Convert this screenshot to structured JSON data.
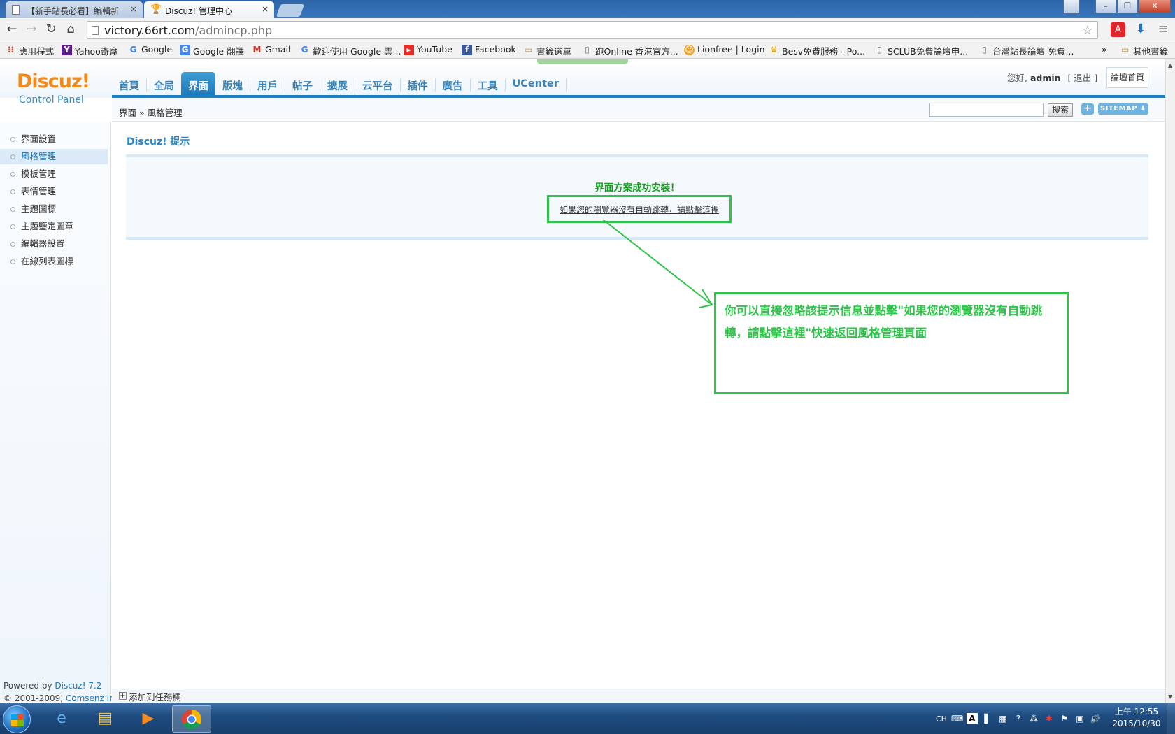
{
  "browser": {
    "tabs": [
      {
        "title": "【新手站長必看】編輯新",
        "active": false
      },
      {
        "title": "Discuz! 管理中心",
        "active": true
      }
    ],
    "url_host": "victory.66rt.com",
    "url_path": "/admincp.php",
    "bookmarks": [
      {
        "label": "應用程式",
        "icon": "apps-grid-icon"
      },
      {
        "label": "Yahoo奇摩",
        "icon": "yahoo-icon"
      },
      {
        "label": "Google",
        "icon": "google-icon"
      },
      {
        "label": "Google 翻譯",
        "icon": "google-translate-icon"
      },
      {
        "label": "Gmail",
        "icon": "gmail-icon"
      },
      {
        "label": "歡迎使用 Google 雲...",
        "icon": "google-icon"
      },
      {
        "label": "YouTube",
        "icon": "youtube-icon"
      },
      {
        "label": "Facebook",
        "icon": "facebook-icon"
      },
      {
        "label": "書籤選單",
        "icon": "folder-icon"
      },
      {
        "label": "跑Online 香港官方...",
        "icon": "page-icon"
      },
      {
        "label": "Lionfree | Login",
        "icon": "lionfree-icon"
      },
      {
        "label": "Besv免費服務 - Po...",
        "icon": "trophy-icon"
      },
      {
        "label": "SCLUB免費論壇申...",
        "icon": "page-icon"
      },
      {
        "label": "台灣站長論壇-免費...",
        "icon": "page-icon"
      }
    ],
    "bookmarks_overflow": "»",
    "other_bookmarks": "其他書籤"
  },
  "admin": {
    "logo": "Discuz!",
    "logo_sub": "Control Panel",
    "nav": [
      "首頁",
      "全局",
      "界面",
      "版塊",
      "用戶",
      "帖子",
      "擴展",
      "云平台",
      "插件",
      "廣告",
      "工具",
      "UCenter"
    ],
    "nav_active": "界面",
    "greeting": "您好,",
    "username": "admin",
    "logout": "[ 退出 ]",
    "forum_home": "論壇首頁",
    "breadcrumb": "界面 » 風格管理",
    "search_button": "搜索",
    "plus": "+",
    "sitemap": "SITEMAP ⬇",
    "sidebar": [
      {
        "label": "界面設置",
        "active": false
      },
      {
        "label": "風格管理",
        "active": true
      },
      {
        "label": "模板管理",
        "active": false
      },
      {
        "label": "表情管理",
        "active": false
      },
      {
        "label": "主題圖標",
        "active": false
      },
      {
        "label": "主題鑒定圖章",
        "active": false
      },
      {
        "label": "編輯器設置",
        "active": false
      },
      {
        "label": "在線列表圖標",
        "active": false
      }
    ],
    "powered_prefix": "Powered by ",
    "powered_name": "Discuz! 7.2",
    "copyright_prefix": "© 2001-2009, ",
    "copyright_name": "Comsenz Inc.",
    "main_title": "Discuz! 提示",
    "success_message": "界面方案成功安裝！",
    "redirect_link": "如果您的瀏覽器沒有自動跳轉，請點擊這裡",
    "add_to_taskbar": "添加到任務欄"
  },
  "annotation": {
    "text": "你可以直接忽略該提示信息並點擊\"如果您的瀏覽器沒有自動跳轉，請點擊這裡\"快速返回風格管理頁面",
    "color": "#2ec44a"
  },
  "taskbar": {
    "apps": [
      "internet-explorer-icon",
      "file-explorer-icon",
      "media-player-icon",
      "chrome-icon"
    ],
    "tray_lang": "CH",
    "time": "上午 12:55",
    "date": "2015/10/30"
  }
}
